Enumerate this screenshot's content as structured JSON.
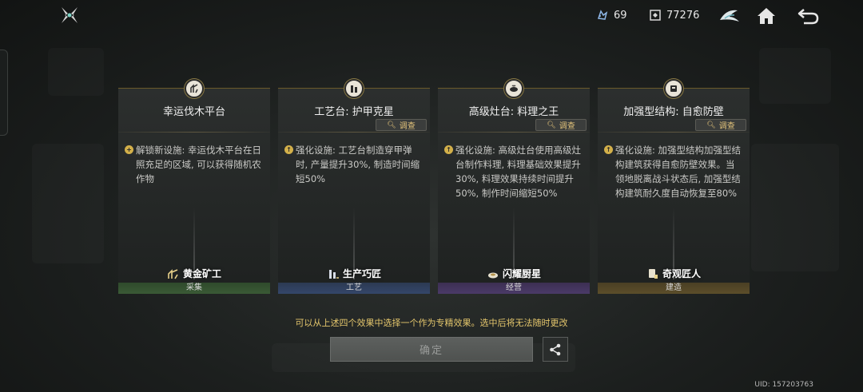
{
  "top_bar": {
    "ore_count": "69",
    "coin_count": "77276",
    "icons": [
      "game-logo-icon",
      "ore-icon",
      "coin-icon",
      "emblem-icon",
      "home-icon",
      "back-icon"
    ]
  },
  "cards": [
    {
      "title": "幸运伐木平台",
      "description": "解锁新设施: 幸运伐木平台在日照充足的区域, 可以获得随机农作物",
      "reward": "黄金矿工",
      "category": "采集",
      "category_color": "#3a5a35"
    },
    {
      "title": "工艺台: 护甲克星",
      "inspect_label": "调查",
      "description": "强化设施: 工艺台制造穿甲弹时, 产量提升30%, 制造时间缩短50%",
      "reward": "生产巧匠",
      "category": "工艺",
      "category_color": "#34466a"
    },
    {
      "title": "高级灶台: 料理之王",
      "inspect_label": "调查",
      "description": "强化设施: 高级灶台使用高级灶台制作料理, 料理基础效果提升30%, 料理效果持续时间提升50%, 制作时间缩短50%",
      "reward": "闪耀厨星",
      "category": "经营",
      "category_color": "#4a3a68"
    },
    {
      "title": "加强型结构: 自愈防壁",
      "inspect_label": "调查",
      "description": "强化设施: 加强型结构加强型结构建筑获得自愈防壁效果。当领地脱离战斗状态后, 加强型结构建筑耐久度自动恢复至80%",
      "reward": "奇观匠人",
      "category": "建造",
      "category_color": "#5c4e2a"
    }
  ],
  "hint": "可以从上述四个效果中选择一个作为专精效果。选中后将无法随时更改",
  "confirm_label": "确定",
  "uid": "UID: 157203763",
  "colors": {
    "accent_gold": "#e4c66c",
    "card_bg": "#262928"
  }
}
